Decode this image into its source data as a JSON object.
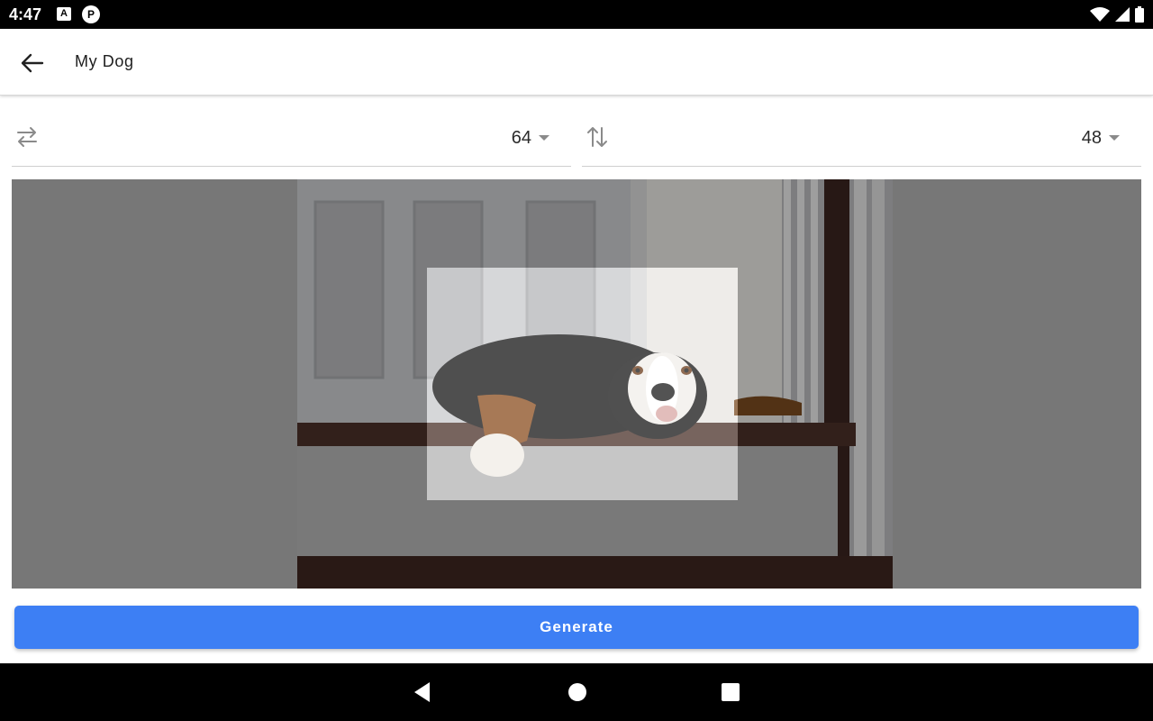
{
  "status_bar": {
    "time": "4:47",
    "notif_a": "A",
    "notif_p": "P"
  },
  "app_bar": {
    "title": "My Dog",
    "back_icon": "arrow-back-icon"
  },
  "controls": {
    "width_icon": "swap-horizontal-icon",
    "width_value": "64",
    "height_icon": "swap-vertical-icon",
    "height_value": "48"
  },
  "image": {
    "subject": "bernese-mountain-dog",
    "crop_icon": "crop-selection"
  },
  "generate_button": {
    "label": "Generate",
    "color": "#3d7ff4"
  },
  "nav_bar": {
    "back_icon": "triangle-back-icon",
    "home_icon": "circle-home-icon",
    "recents_icon": "square-recents-icon"
  }
}
